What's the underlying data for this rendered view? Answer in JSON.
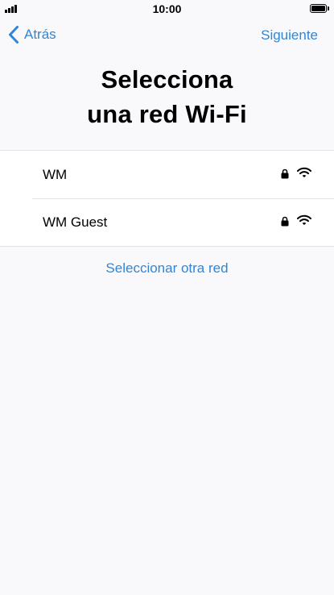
{
  "status_bar": {
    "time": "10:00",
    "icons": [
      "cellular-signal-icon",
      "battery-icon"
    ]
  },
  "nav": {
    "back_label": "Atrás",
    "next_label": "Siguiente",
    "back_icon": "chevron-left-icon"
  },
  "title": {
    "line1": "Selecciona",
    "line2": "una red Wi-Fi"
  },
  "networks": [
    {
      "name": "WM",
      "icons": [
        "lock-icon",
        "wifi-icon"
      ]
    },
    {
      "name": "WM Guest",
      "icons": [
        "lock-icon",
        "wifi-icon"
      ]
    }
  ],
  "other_network_label": "Seleccionar otra red",
  "colors": {
    "accent": "#2f86d6",
    "background": "#f9f9fb",
    "list_background": "#ffffff",
    "separator": "#e3e3e6"
  }
}
